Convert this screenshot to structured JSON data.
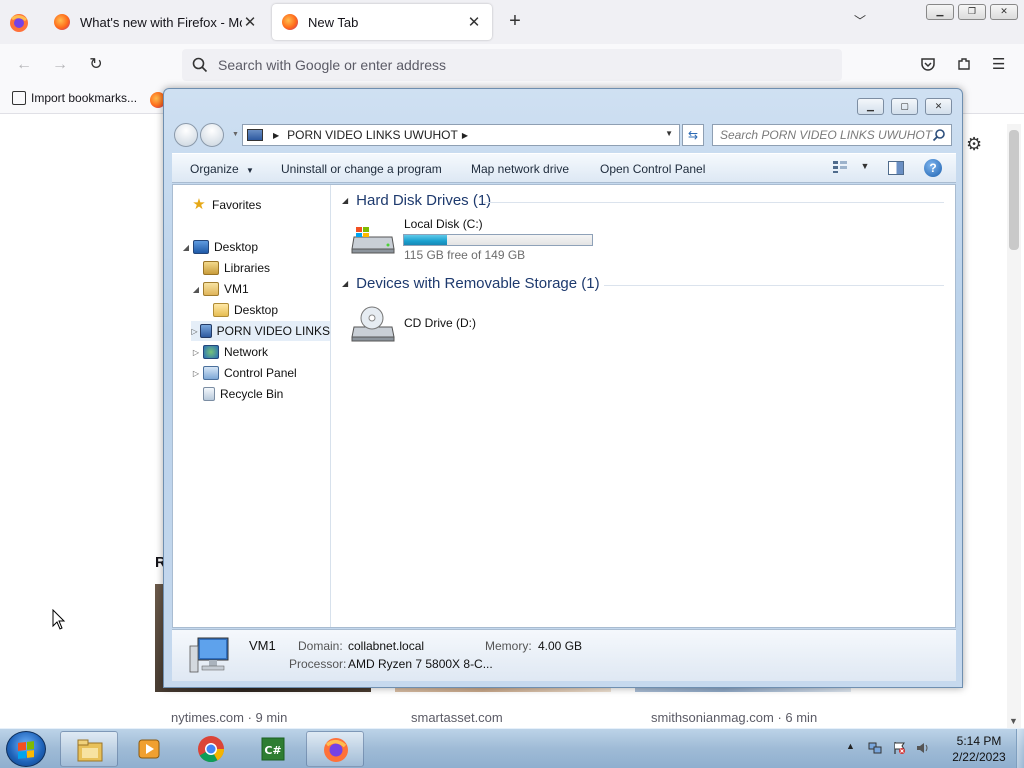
{
  "firefox": {
    "tabs": [
      {
        "label": "What's new with Firefox - More"
      },
      {
        "label": "New Tab"
      }
    ],
    "urlbar_placeholder": "Search with Google or enter address",
    "bookmarks": {
      "import_label": "Import bookmarks..."
    }
  },
  "newtab": {
    "recommended_heading_partial": "R",
    "cards": [
      {
        "source": "nytimes.com · 9 min"
      },
      {
        "source": "smartasset.com"
      },
      {
        "source": "smithsonianmag.com · 6 min"
      }
    ]
  },
  "explorer": {
    "address": {
      "path": "PORN VIDEO LINKS  UWUHOT"
    },
    "search_placeholder": "Search PORN VIDEO LINKS  UWUHOT",
    "toolbar": {
      "organize": "Organize",
      "uninstall": "Uninstall or change a program",
      "map_drive": "Map network drive",
      "open_cp": "Open Control Panel"
    },
    "nav": {
      "favorites": "Favorites",
      "desktop": "Desktop",
      "libraries": "Libraries",
      "vm1": "VM1",
      "vm1_desktop": "Desktop",
      "computer": "PORN VIDEO LINKS",
      "network": "Network",
      "control_panel": "Control Panel",
      "recycle_bin": "Recycle Bin"
    },
    "groups": {
      "hdd_header": "Hard Disk Drives (1)",
      "removable_header": "Devices with Removable Storage (1)"
    },
    "drives": {
      "c": {
        "name": "Local Disk (C:)",
        "free_text": "115 GB free of 149 GB",
        "used_fraction": 0.23
      },
      "d": {
        "name": "CD Drive (D:)"
      }
    },
    "details": {
      "name": "VM1",
      "domain_label": "Domain:",
      "domain_value": "collabnet.local",
      "memory_label": "Memory:",
      "memory_value": "4.00 GB",
      "processor_label": "Processor:",
      "processor_value": "AMD Ryzen 7 5800X 8-C..."
    }
  },
  "taskbar": {
    "apps": [
      "windows-explorer",
      "media-player",
      "chrome",
      "csharp-editor",
      "firefox"
    ],
    "clock_time": "5:14 PM",
    "clock_date": "2/22/2023"
  },
  "colors": {
    "explorer_header": "#1e3a6e",
    "drive_bar_fill": "#1aa0cf",
    "taskbar": "#9fbbd6"
  }
}
